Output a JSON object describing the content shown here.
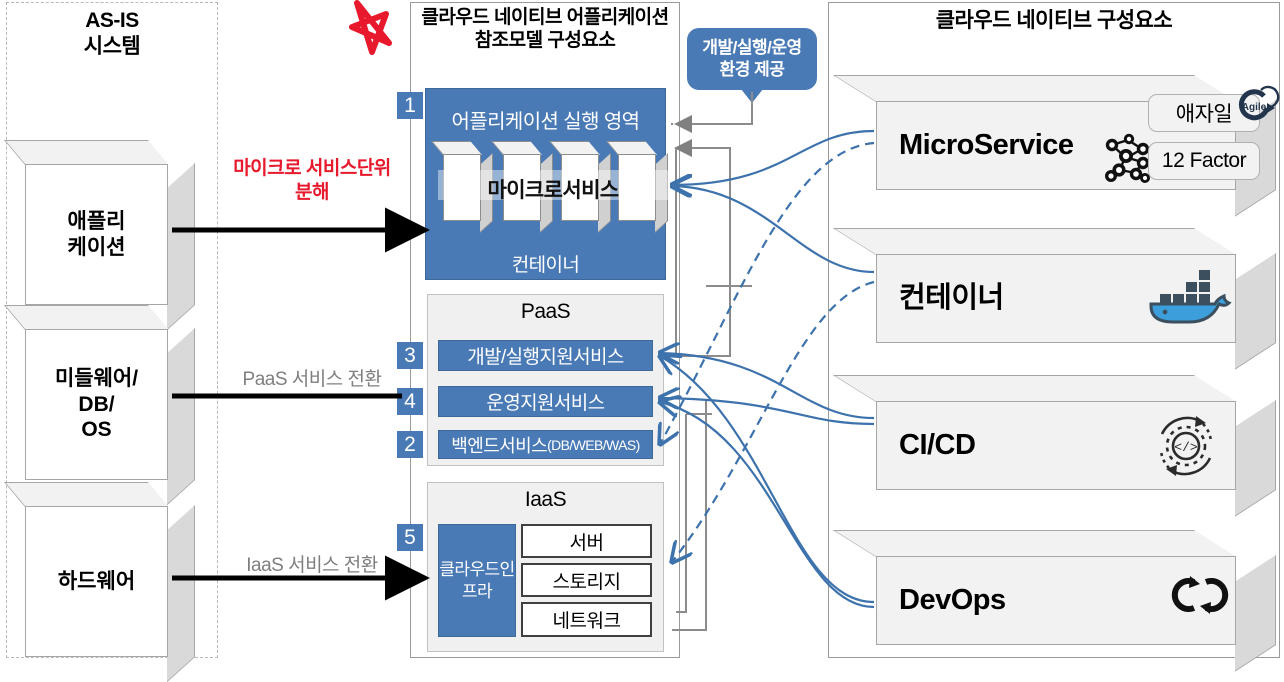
{
  "panels": {
    "asis": {
      "title_line1": "AS-IS",
      "title_line2": "시스템"
    },
    "reference": {
      "title_line1": "클라우드 네이티브 어플리케이션",
      "title_line2": "참조모델 구성요소"
    },
    "components": {
      "title": "클라우드 네이티브 구성요소"
    }
  },
  "asis_boxes": [
    {
      "label_line1": "애플리",
      "label_line2": "케이션"
    },
    {
      "label_line1": "미들웨어/",
      "label_line2": "DB/",
      "label_line3": "OS"
    },
    {
      "label_line1": "하드웨어"
    }
  ],
  "transition_labels": {
    "microservice_decompose_line1": "마이크로 서비스단위",
    "microservice_decompose_line2": "분해",
    "paas": "PaaS 서비스 전환",
    "iaas": "IaaS 서비스 전환"
  },
  "bubble": {
    "line1": "개발/실행/운영",
    "line2": "환경 제공"
  },
  "app_layer": {
    "badge": "1",
    "title": "어플리케이션 실행 영역",
    "microservice_label": "마이크로서비스",
    "container_label": "컨테이너"
  },
  "paas": {
    "title": "PaaS",
    "rows": [
      {
        "badge": "3",
        "label": "개발/실행지원서비스",
        "suffix": ""
      },
      {
        "badge": "4",
        "label": "운영지원서비스",
        "suffix": ""
      },
      {
        "badge": "2",
        "label": "백엔드서비스",
        "suffix": "(DB/WEB/WAS)"
      }
    ]
  },
  "iaas": {
    "title": "IaaS",
    "badge": "5",
    "infra_label_line1": "클라우드인",
    "infra_label_line2": "프라",
    "cells": [
      "서버",
      "스토리지",
      "네트워크"
    ]
  },
  "components": [
    {
      "label": "MicroService",
      "icon": "microservice-network-icon",
      "pills": [
        "애자일",
        "12 Factor"
      ],
      "badge_icon": "agile-cycle-icon"
    },
    {
      "label": "컨테이너",
      "icon": "docker-whale-icon",
      "pills": []
    },
    {
      "label": "CI/CD",
      "icon": "cicd-gear-icon",
      "pills": []
    },
    {
      "label": "DevOps",
      "icon": "devops-infinity-icon",
      "pills": []
    }
  ],
  "marks": {
    "star": "red-star-mark"
  },
  "colors": {
    "accent_blue": "#4a7ab5",
    "red": "#e8192c",
    "grey_text": "#7f7f7f",
    "box_grey": "#f2f2f2",
    "side_grey": "#d9d9d9"
  }
}
